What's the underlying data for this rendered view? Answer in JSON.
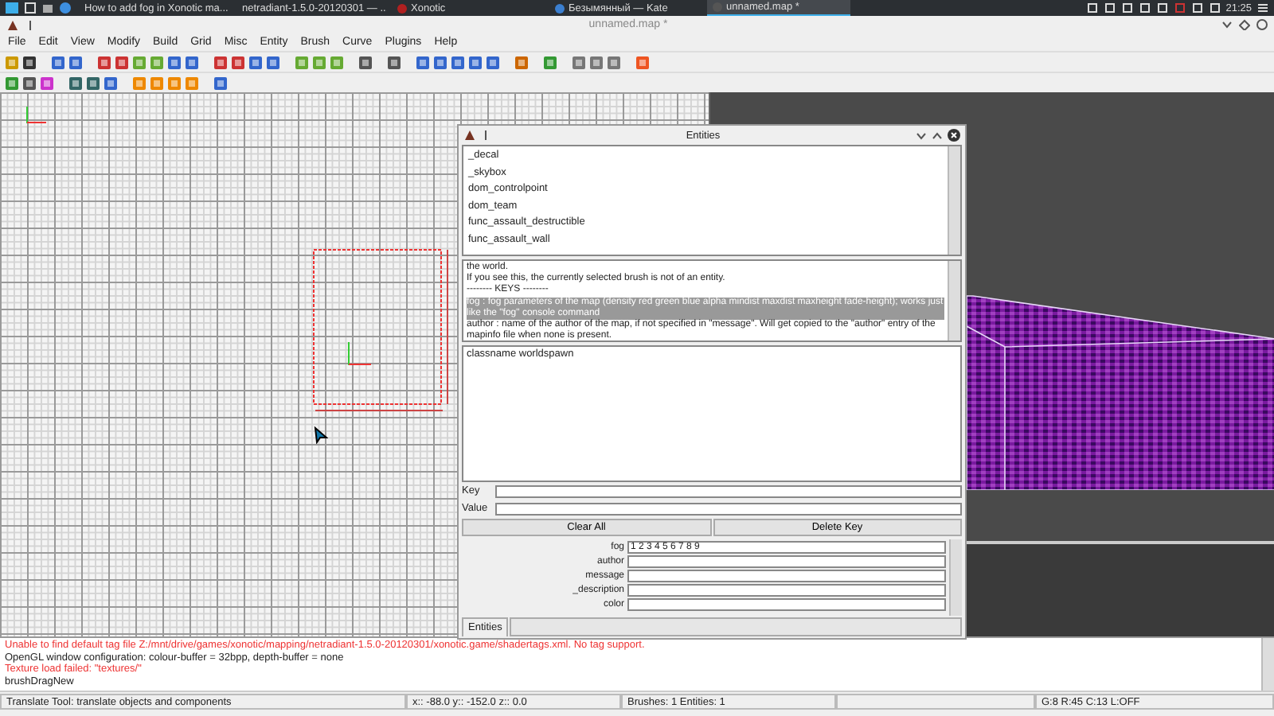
{
  "taskbar": {
    "tasks": [
      {
        "label": "How to add fog in Xonotic ma...",
        "selected": false
      },
      {
        "label": "netradiant-1.5.0-20120301 — ...",
        "selected": false
      },
      {
        "label": "Xonotic",
        "selected": false
      },
      {
        "label": "Безымянный  — Kate",
        "selected": false
      },
      {
        "label": "unnamed.map *",
        "selected": true
      }
    ],
    "clock": "21:25"
  },
  "window": {
    "title": "unnamed.map *"
  },
  "menu": [
    "File",
    "Edit",
    "View",
    "Modify",
    "Build",
    "Grid",
    "Misc",
    "Entity",
    "Brush",
    "Curve",
    "Plugins",
    "Help"
  ],
  "entities": {
    "title": "Entities",
    "classes": [
      "_decal",
      "_skybox",
      "dom_controlpoint",
      "dom_team",
      "func_assault_destructible",
      "func_assault_wall"
    ],
    "description": [
      {
        "text": "the world.",
        "highlighted": false
      },
      {
        "text": "If you see this, the currently selected brush is not of an entity.",
        "highlighted": false
      },
      {
        "text": "-------- KEYS --------",
        "highlighted": false
      },
      {
        "text": "fog : fog parameters of the map (density red green blue alpha mindist maxdist maxheight fade-height); works just like the \"fog\" console command",
        "highlighted": true
      },
      {
        "text": "author : name of the author of the map, if not specified in \"message\". Will get copied to the \"author\" entry of the mapinfo file when none is present.",
        "highlighted": false
      }
    ],
    "keyvalues": [
      "classname  worldspawn"
    ],
    "key_label": "Key",
    "value_label": "Value",
    "buttons": [
      "Clear All",
      "Delete Key"
    ],
    "properties": [
      {
        "key": "fog",
        "value": "1 2 3 4 5 6 7 8 9"
      },
      {
        "key": "author"
      },
      {
        "key": "message"
      },
      {
        "key": "_description"
      },
      {
        "key": "color"
      }
    ],
    "tab": "Entities"
  },
  "console": [
    {
      "kind": "error",
      "text": "Unable to find default tag file Z:/mnt/drive/games/xonotic/mapping/netradiant-1.5.0-20120301/xonotic.game/shadertags.xml. No tag support."
    },
    {
      "kind": "info",
      "text": "OpenGL window configuration: colour-buffer = 32bpp, depth-buffer = none"
    },
    {
      "kind": "error",
      "text": "Texture load failed: \"textures/\""
    },
    {
      "kind": "info",
      "text": "brushDragNew"
    }
  ],
  "status_bar": [
    "Translate Tool: translate objects and components",
    "x::  -88.0  y::  -152.0  z::    0.0",
    "Brushes: 1 Entities: 1",
    "G:8  R:45  C:13  L:OFF"
  ]
}
